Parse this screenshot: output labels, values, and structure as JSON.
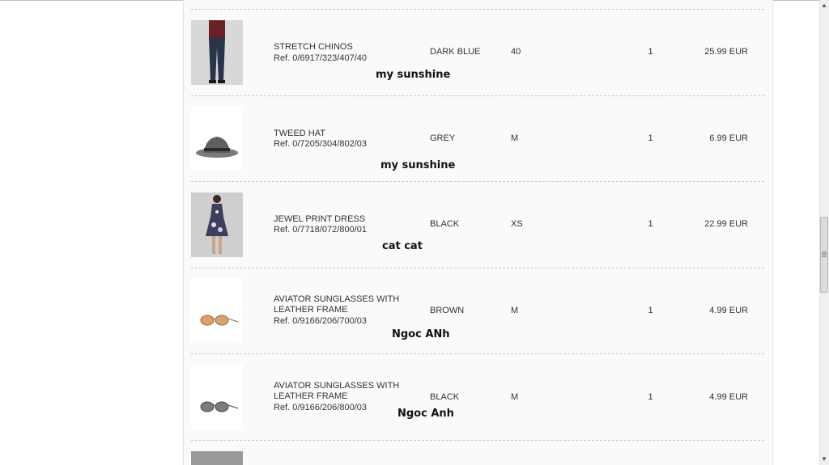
{
  "items": [
    {
      "name": "STRETCH CHINOS",
      "ref": "Ref. 0/6917/323/407/40",
      "color": "DARK BLUE",
      "size": "40",
      "qty": "1",
      "price": "25.99 EUR",
      "note": "my sunshine",
      "image": "chinos-photo"
    },
    {
      "name": "TWEED HAT",
      "ref": "Ref. 0/7205/304/802/03",
      "color": "GREY",
      "size": "M",
      "qty": "1",
      "price": "6.99 EUR",
      "note": "my sunshine",
      "image": "hat-photo"
    },
    {
      "name": "JEWEL PRINT DRESS",
      "ref": "Ref. 0/7718/072/800/01",
      "color": "BLACK",
      "size": "XS",
      "qty": "1",
      "price": "22.99 EUR",
      "note": "cat cat",
      "image": "dress-photo"
    },
    {
      "name": "AVIATOR SUNGLASSES WITH LEATHER FRAME",
      "ref": "Ref. 0/9166/206/700/03",
      "color": "BROWN",
      "size": "M",
      "qty": "1",
      "price": "4.99 EUR",
      "note": "Ngoc ANh",
      "image": "sunglasses-brown-photo"
    },
    {
      "name": "AVIATOR SUNGLASSES WITH LEATHER FRAME",
      "ref": "Ref. 0/9166/206/800/03",
      "color": "BLACK",
      "size": "M",
      "qty": "1",
      "price": "4.99 EUR",
      "note": "Ngoc Anh",
      "image": "sunglasses-black-photo"
    }
  ],
  "colors": {
    "panel_bg": "#fafafa",
    "separator": "#c9c9c9",
    "text": "#333333"
  }
}
